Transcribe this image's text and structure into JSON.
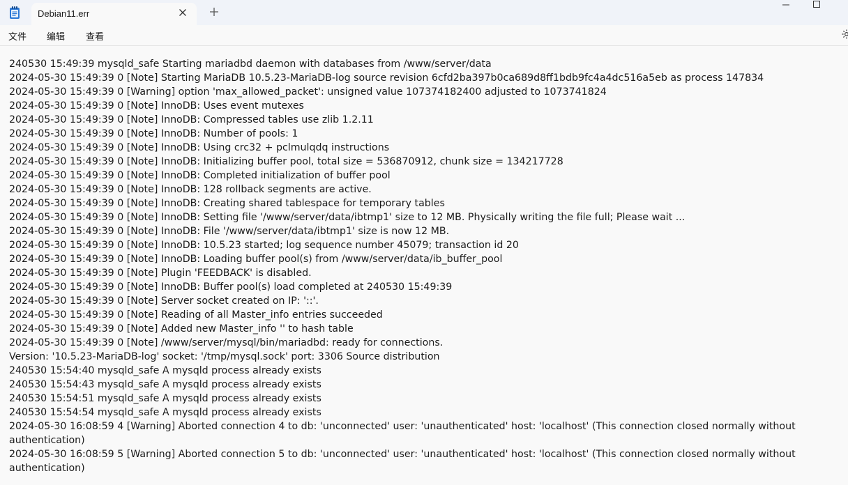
{
  "window": {
    "tab_title": "Debian11.err",
    "minimize_glyph": "—",
    "maximize_glyph": "□"
  },
  "menu": {
    "file": "文件",
    "edit": "编辑",
    "view": "查看"
  },
  "icons": {
    "app": "notepad-icon",
    "close_tab": "close-icon",
    "new_tab": "plus-icon",
    "settings": "gear-icon"
  },
  "log_lines": [
    "240530 15:49:39 mysqld_safe Starting mariadbd daemon with databases from /www/server/data",
    "2024-05-30 15:49:39 0 [Note] Starting MariaDB 10.5.23-MariaDB-log source revision 6cfd2ba397b0ca689d8ff1bdb9fc4a4dc516a5eb as process 147834",
    "2024-05-30 15:49:39 0 [Warning] option 'max_allowed_packet': unsigned value 107374182400 adjusted to 1073741824",
    "2024-05-30 15:49:39 0 [Note] InnoDB: Uses event mutexes",
    "2024-05-30 15:49:39 0 [Note] InnoDB: Compressed tables use zlib 1.2.11",
    "2024-05-30 15:49:39 0 [Note] InnoDB: Number of pools: 1",
    "2024-05-30 15:49:39 0 [Note] InnoDB: Using crc32 + pclmulqdq instructions",
    "2024-05-30 15:49:39 0 [Note] InnoDB: Initializing buffer pool, total size = 536870912, chunk size = 134217728",
    "2024-05-30 15:49:39 0 [Note] InnoDB: Completed initialization of buffer pool",
    "2024-05-30 15:49:39 0 [Note] InnoDB: 128 rollback segments are active.",
    "2024-05-30 15:49:39 0 [Note] InnoDB: Creating shared tablespace for temporary tables",
    "2024-05-30 15:49:39 0 [Note] InnoDB: Setting file '/www/server/data/ibtmp1' size to 12 MB. Physically writing the file full; Please wait ...",
    "2024-05-30 15:49:39 0 [Note] InnoDB: File '/www/server/data/ibtmp1' size is now 12 MB.",
    "2024-05-30 15:49:39 0 [Note] InnoDB: 10.5.23 started; log sequence number 45079; transaction id 20",
    "2024-05-30 15:49:39 0 [Note] InnoDB: Loading buffer pool(s) from /www/server/data/ib_buffer_pool",
    "2024-05-30 15:49:39 0 [Note] Plugin 'FEEDBACK' is disabled.",
    "2024-05-30 15:49:39 0 [Note] InnoDB: Buffer pool(s) load completed at 240530 15:49:39",
    "2024-05-30 15:49:39 0 [Note] Server socket created on IP: '::'.",
    "2024-05-30 15:49:39 0 [Note] Reading of all Master_info entries succeeded",
    "2024-05-30 15:49:39 0 [Note] Added new Master_info '' to hash table",
    "2024-05-30 15:49:39 0 [Note] /www/server/mysql/bin/mariadbd: ready for connections.",
    "Version: '10.5.23-MariaDB-log'  socket: '/tmp/mysql.sock'  port: 3306  Source distribution",
    "240530 15:54:40 mysqld_safe A mysqld process already exists",
    "240530 15:54:43 mysqld_safe A mysqld process already exists",
    "240530 15:54:51 mysqld_safe A mysqld process already exists",
    "240530 15:54:54 mysqld_safe A mysqld process already exists",
    "2024-05-30 16:08:59 4 [Warning] Aborted connection 4 to db: 'unconnected' user: 'unauthenticated' host: 'localhost' (This connection closed normally without authentication)",
    "2024-05-30 16:08:59 5 [Warning] Aborted connection 5 to db: 'unconnected' user: 'unauthenticated' host: 'localhost' (This connection closed normally without authentication)"
  ]
}
